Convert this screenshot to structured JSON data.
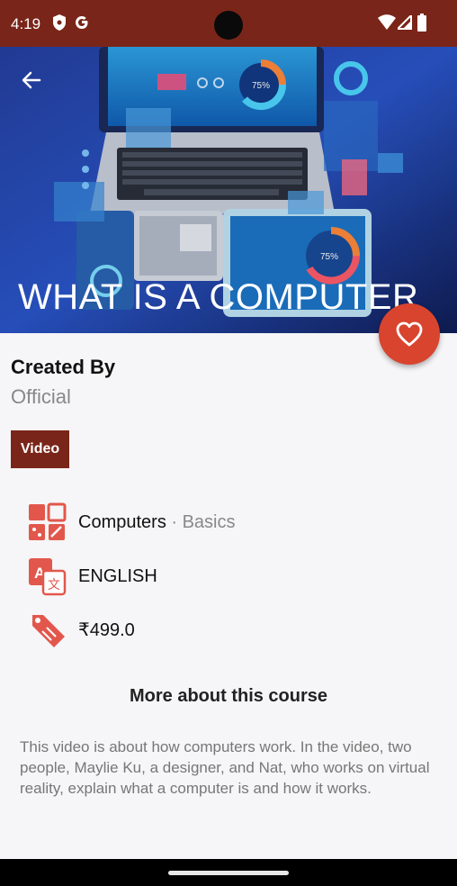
{
  "status_bar": {
    "time": "4:19"
  },
  "course": {
    "title": "WHAT IS A COMPUTER",
    "created_by_label": "Created By",
    "creator": "Official",
    "type_badge": "Video",
    "category": "Computers",
    "separator": " · ",
    "subcategory": "Basics",
    "language": "ENGLISH",
    "price": "₹499.0"
  },
  "more": {
    "title": "More about this course",
    "description": "This video is about how computers work. In the video, two people, Maylie Ku, a designer, and Nat, who works on virtual reality, explain what a computer is and how it works."
  },
  "colors": {
    "accent": "#d9442e",
    "brand_dark": "#7a2519",
    "icon": "#e2574c"
  },
  "icons": [
    "back-arrow-icon",
    "heart-icon",
    "category-grid-icon",
    "translate-icon",
    "price-tag-icon"
  ]
}
